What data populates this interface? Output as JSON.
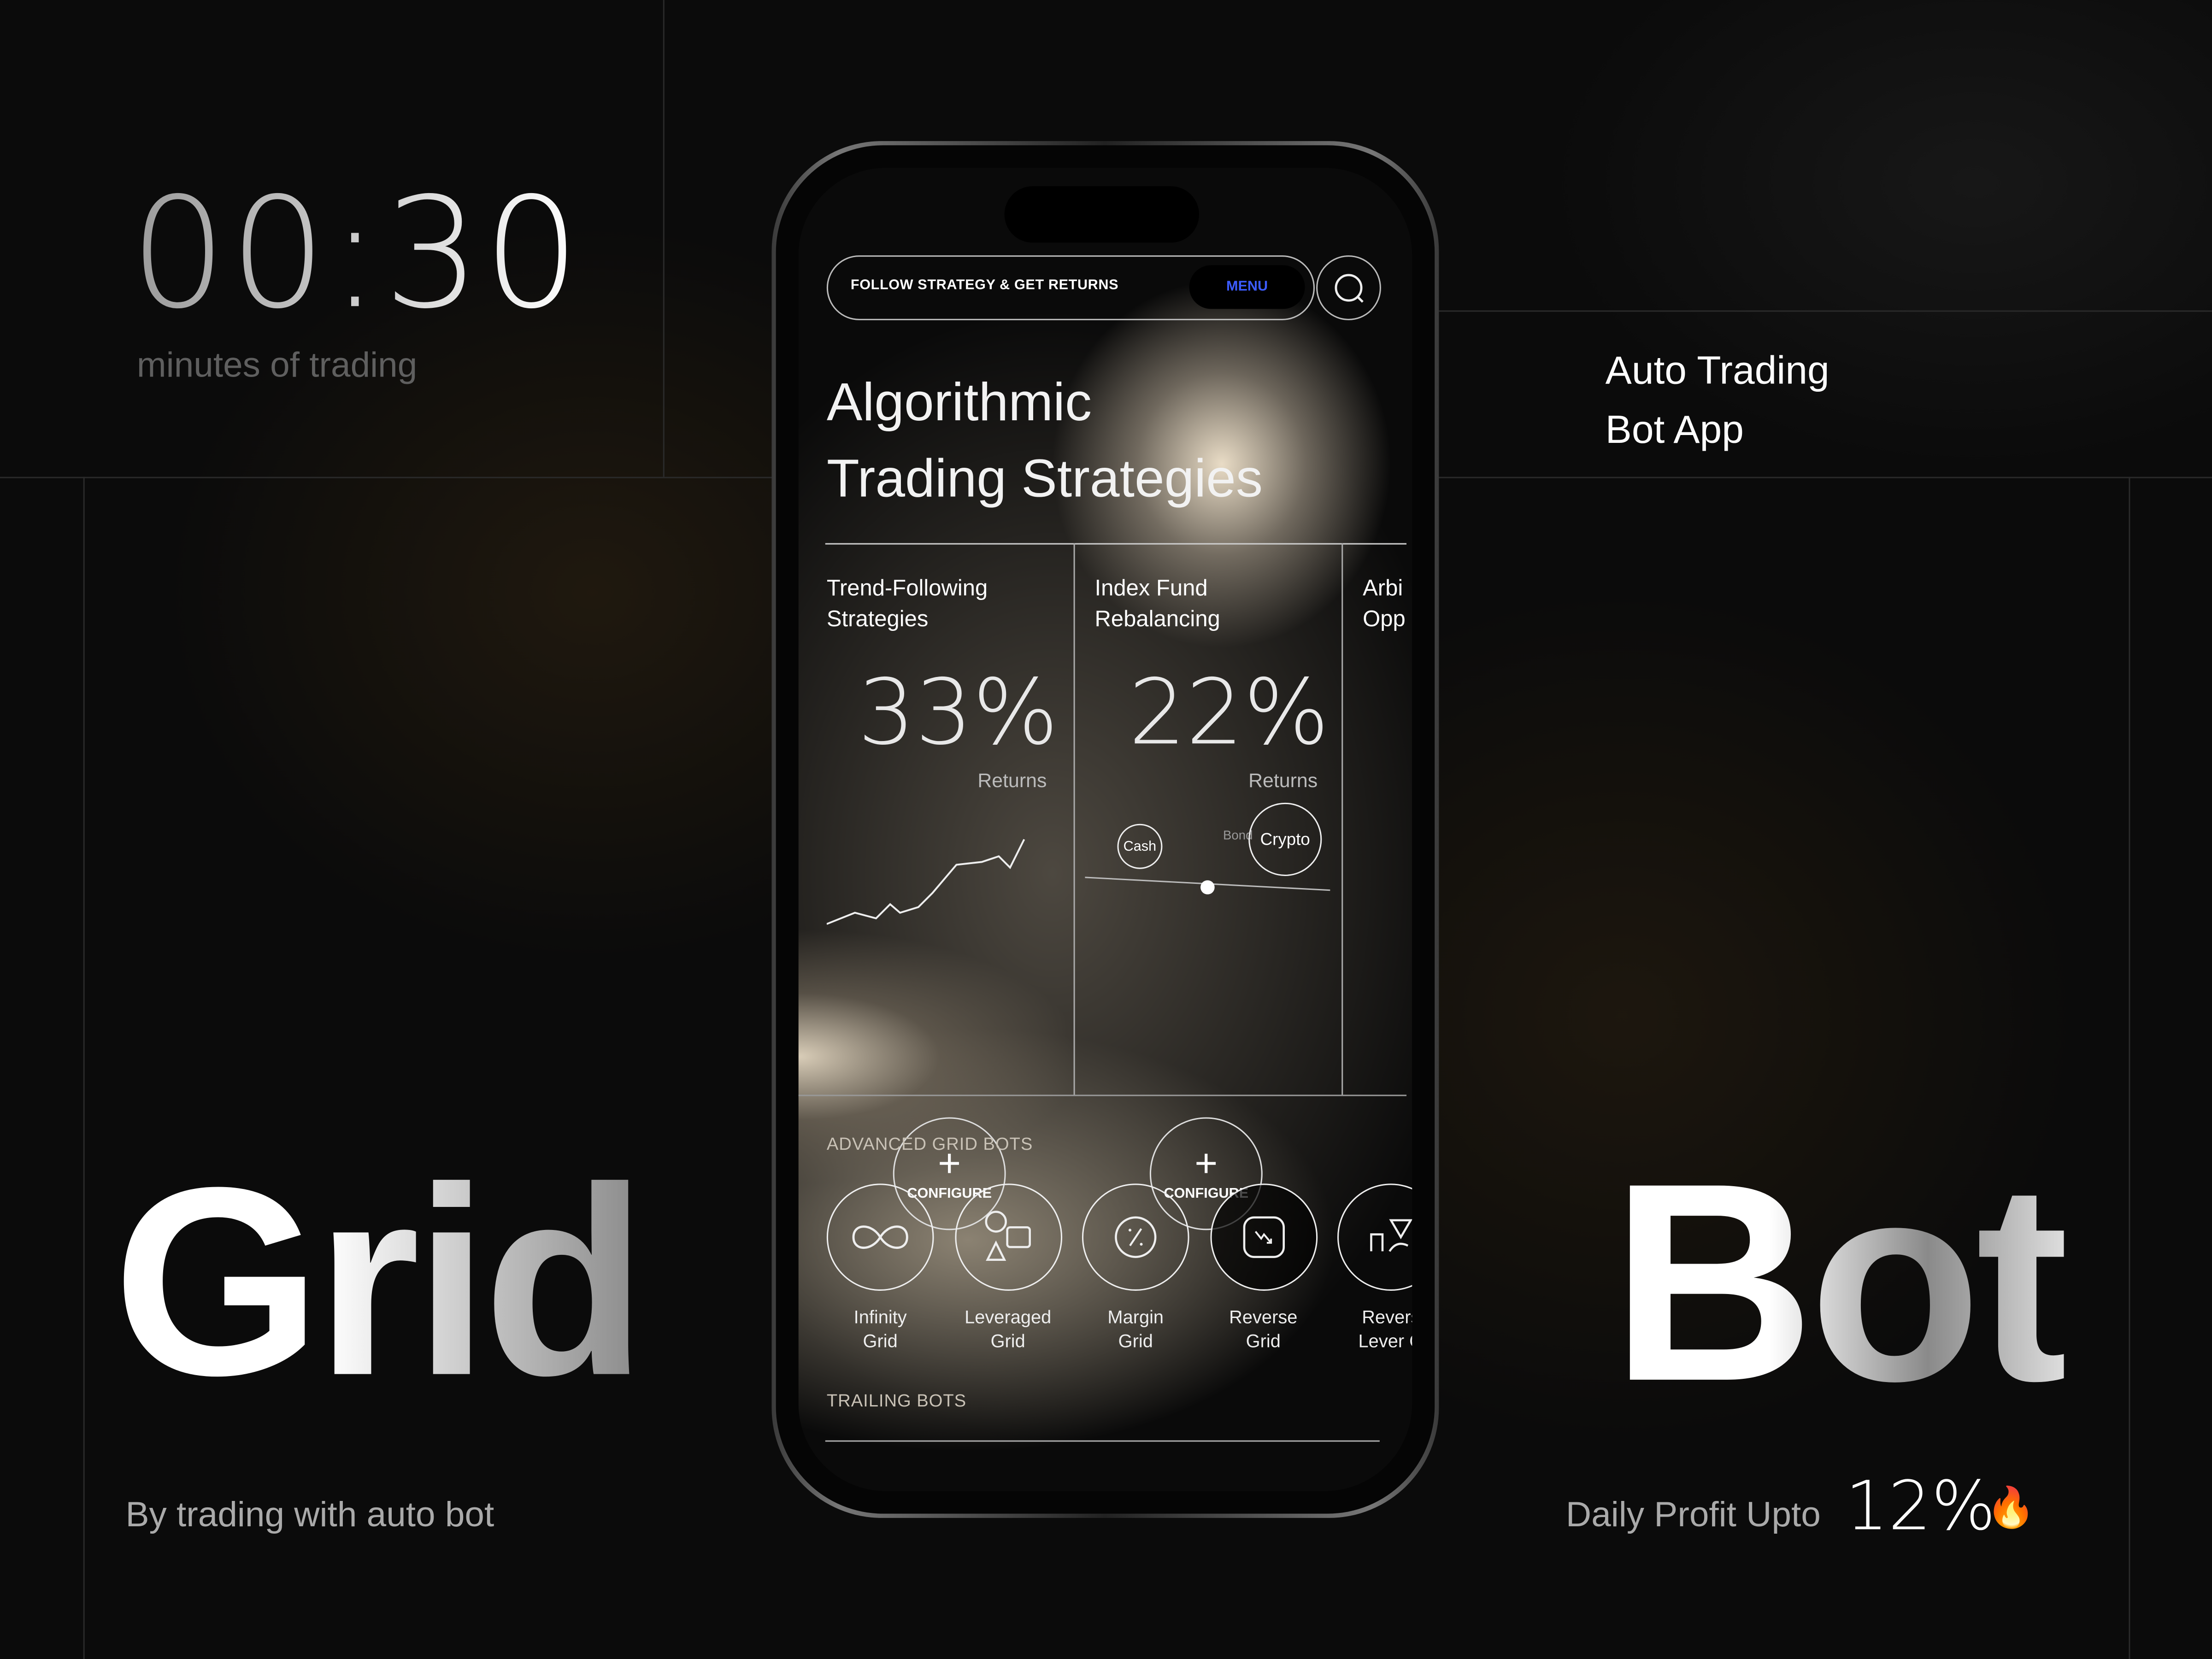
{
  "left_panel": {
    "timer": "00:30",
    "timer_caption": "minutes of trading",
    "headline": "Grid",
    "tagline": "By trading with auto bot"
  },
  "right_panel": {
    "title_line1": "Auto Trading",
    "title_line2": "Bot App",
    "headline": "Bot",
    "profit_label": "Daily Profit Upto",
    "profit_value": "12%",
    "profit_icon": "fire-icon"
  },
  "app": {
    "header": {
      "tagline": "FOLLOW STRATEGY & GET RETURNS",
      "menu_label": "MENU",
      "search_icon": "search-icon",
      "menu_color": "#3c5cff"
    },
    "title_line1": "Algorithmic",
    "title_line2": "Trading Strategies",
    "strategies": [
      {
        "name_line1": "Trend-Following",
        "name_line2": "Strategies",
        "returns": "33%",
        "returns_label": "Returns",
        "configure_label": "CONFIGURE"
      },
      {
        "name_line1": "Index Fund",
        "name_line2": "Rebalancing",
        "returns": "22%",
        "returns_label": "Returns",
        "configure_label": "CONFIGURE",
        "allocation": [
          "Cash",
          "Bond",
          "Crypto"
        ]
      },
      {
        "name_line1": "Arbi",
        "name_line2": "Opp"
      }
    ],
    "advanced_title": "ADVANCED GRID BOTS",
    "bots": [
      {
        "line1": "Infinity",
        "line2": "Grid",
        "icon": "infinity-icon"
      },
      {
        "line1": "Leveraged",
        "line2": "Grid",
        "icon": "shapes-icon"
      },
      {
        "line1": "Margin",
        "line2": "Grid",
        "icon": "percent-icon"
      },
      {
        "line1": "Reverse",
        "line2": "Grid",
        "icon": "trend-down-icon"
      },
      {
        "line1": "Revers",
        "line2": "Lever G",
        "icon": "reverse-leverage-icon"
      }
    ],
    "trailing_title": "TRAILING BOTS"
  }
}
